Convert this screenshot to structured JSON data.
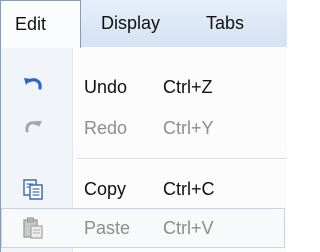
{
  "menubar": {
    "edit": "Edit",
    "display": "Display",
    "tabs": "Tabs"
  },
  "menu": {
    "items": [
      {
        "label": "Undo",
        "shortcut": "Ctrl+Z",
        "icon": "undo-icon",
        "enabled": true
      },
      {
        "label": "Redo",
        "shortcut": "Ctrl+Y",
        "icon": "redo-icon",
        "enabled": false
      },
      {
        "label": "Copy",
        "shortcut": "Ctrl+C",
        "icon": "copy-icon",
        "enabled": true
      },
      {
        "label": "Paste",
        "shortcut": "Ctrl+V",
        "icon": "paste-icon",
        "enabled": false
      }
    ]
  },
  "colors": {
    "menubar": "#d5e2f3",
    "accent": "#2b66c8",
    "disabled_text": "#8d8d8d"
  }
}
